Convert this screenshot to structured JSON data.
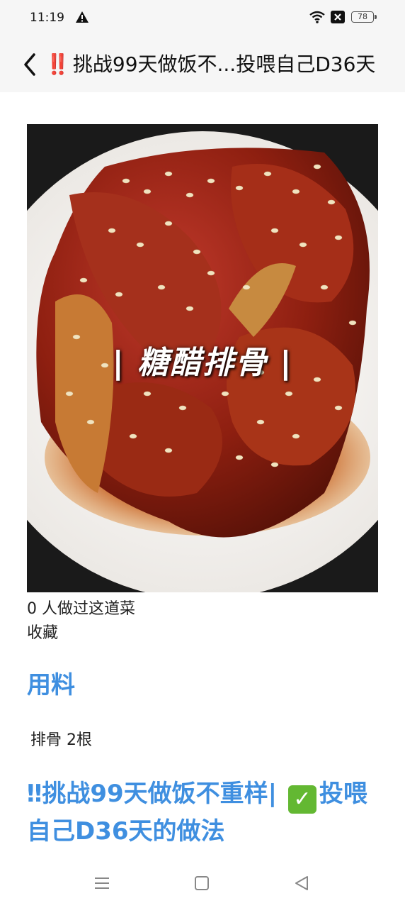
{
  "status_bar": {
    "time": "11:19",
    "battery": "78",
    "icons": [
      "warning-icon",
      "wifi-icon",
      "close-box-icon",
      "battery-icon"
    ]
  },
  "header": {
    "title_marks": "‼️",
    "title": "挑战99天做饭不...投喂自己D36天"
  },
  "dish": {
    "overlay_text": "| 糖醋排骨 |"
  },
  "stats": {
    "made_count": "0 人做过这道菜",
    "favorite": "收藏"
  },
  "ingredients": {
    "heading": "用料",
    "items": [
      "排骨 2根"
    ]
  },
  "method": {
    "heading_part1": "‼挑战99天做饭不重样|",
    "check": "✓",
    "heading_part2": "投喂自己D36天的做法"
  },
  "colors": {
    "accent": "#3f8fe0",
    "check_green": "#63b832"
  }
}
